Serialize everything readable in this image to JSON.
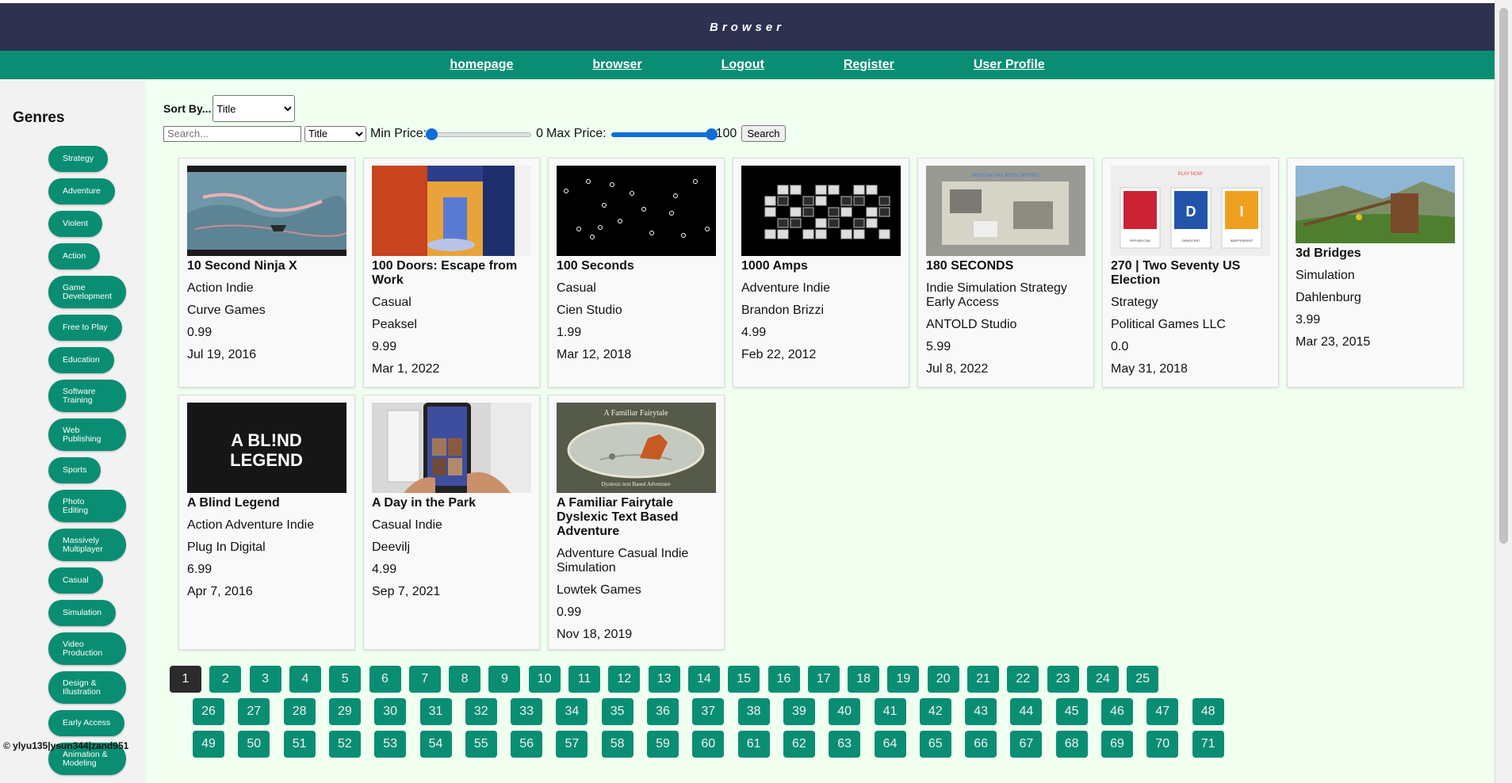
{
  "header": {
    "title": "Browser"
  },
  "nav": [
    "homepage",
    "browser",
    "Logout",
    "Register",
    "User Profile"
  ],
  "sidebar": {
    "title": "Genres",
    "genres": [
      "Strategy",
      "Adventure",
      "Violent",
      "Action",
      "Game Development",
      "Free to Play",
      "Education",
      "Software Training",
      "Web Publishing",
      "Sports",
      "Photo Editing",
      "Massively Multiplayer",
      "Casual",
      "Simulation",
      "Video Production",
      "Design & Illustration",
      "Early Access",
      "Animation & Modeling"
    ],
    "footer": "© ylyu135|ysun344|zand951"
  },
  "controls": {
    "sort_label": "Sort By...",
    "sort_value": "Title",
    "search_placeholder": "Search...",
    "search_field_value": "Title",
    "min_price_label": "Min Price:",
    "min_price_value": "0",
    "max_price_label": "Max Price:",
    "max_price_value": "100",
    "min_slider_fraction": 0,
    "max_slider_fraction": 1,
    "search_button": "Search"
  },
  "games": [
    {
      "title": "10 Second Ninja X",
      "genres": "Action Indie",
      "developer": "Curve Games",
      "price": "0.99",
      "date": "Jul 19, 2016",
      "thumb": "ninja"
    },
    {
      "title": "100 Doors: Escape from Work",
      "genres": "Casual",
      "developer": "Peaksel",
      "price": "9.99",
      "date": "Mar 1, 2022",
      "thumb": "doors"
    },
    {
      "title": "100 Seconds",
      "genres": "Casual",
      "developer": "Cien Studio",
      "price": "1.99",
      "date": "Mar 12, 2018",
      "thumb": "seconds"
    },
    {
      "title": "1000 Amps",
      "genres": "Adventure Indie",
      "developer": "Brandon Brizzi",
      "price": "4.99",
      "date": "Feb 22, 2012",
      "thumb": "amps"
    },
    {
      "title": "180 SECONDS",
      "genres": "Indie Simulation Strategy Early Access",
      "developer": "ANTOLD Studio",
      "price": "5.99",
      "date": "Jul 8, 2022",
      "thumb": "s180"
    },
    {
      "title": "270 | Two Seventy US Election",
      "genres": "Strategy",
      "developer": "Political Games LLC",
      "price": "0.0",
      "date": "May 31, 2018",
      "thumb": "election"
    },
    {
      "title": "3d Bridges",
      "genres": "Simulation",
      "developer": "Dahlenburg",
      "price": "3.99",
      "date": "Mar 23, 2015",
      "thumb": "bridges"
    },
    {
      "title": "A Blind Legend",
      "genres": "Action Adventure Indie",
      "developer": "Plug In Digital",
      "price": "6.99",
      "date": "Apr 7, 2016",
      "thumb": "blind"
    },
    {
      "title": "A Day in the Park",
      "genres": "Casual Indie",
      "developer": "Deevilj",
      "price": "4.99",
      "date": "Sep 7, 2021",
      "thumb": "park"
    },
    {
      "title": "A Familiar Fairytale Dyslexic Text Based Adventure",
      "genres": "Adventure Casual Indie Simulation",
      "developer": "Lowtek Games",
      "price": "0.99",
      "date": "Nov 18, 2019",
      "thumb": "fairytale"
    }
  ],
  "thumb_text": {
    "blind": "A BLIND LEGEND",
    "fairytale_top": "A Familiar Fairytale",
    "fairytale_bottom": "Dyslexic text Based Adventure",
    "election_top": "PLAY NOW",
    "election_labels": [
      "REPUBLICAN",
      "DEMOCRAT",
      "INDEPENDENT"
    ],
    "election_letters": [
      "D",
      "I"
    ],
    "s180_banner": "WINDOW HAS BEEN OPENED"
  },
  "pagination": {
    "current": 1,
    "rows": [
      [
        1,
        25
      ],
      [
        26,
        48
      ],
      [
        49,
        71
      ]
    ]
  }
}
